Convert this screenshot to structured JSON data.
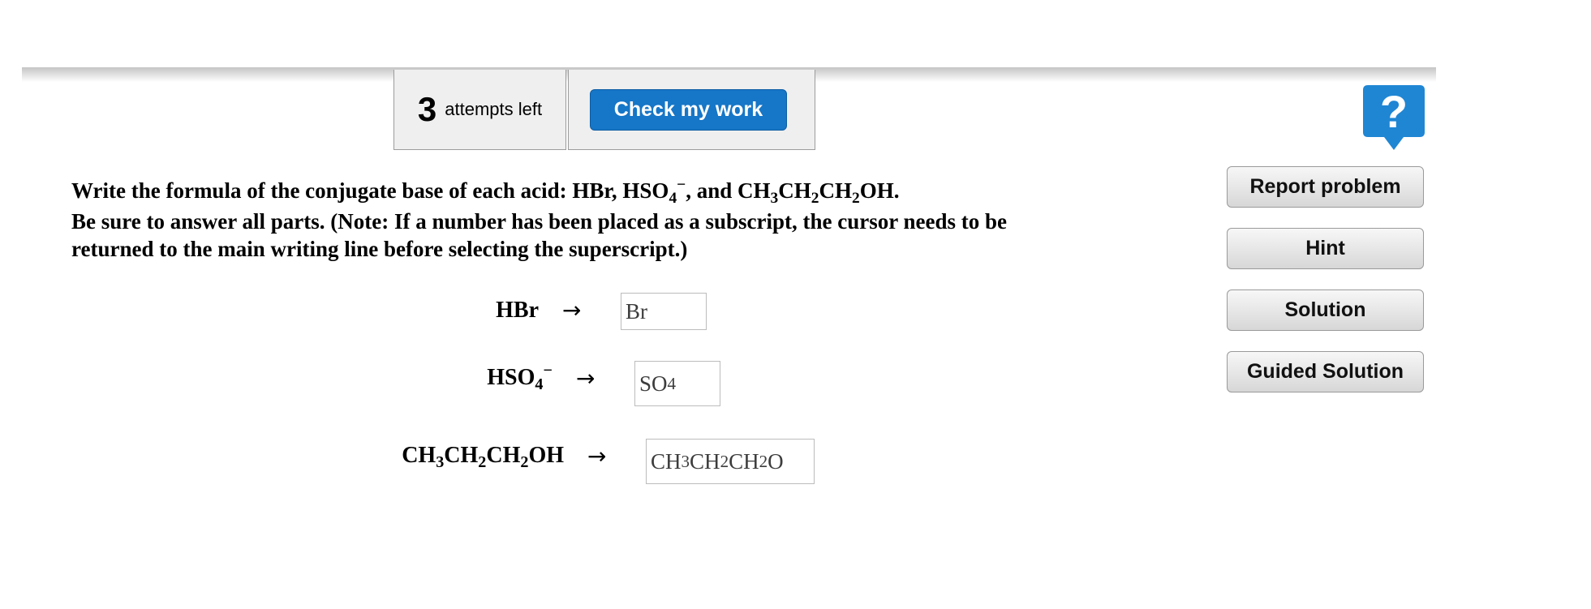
{
  "toolbar": {
    "attempts_count": "3",
    "attempts_text": "attempts left",
    "check_label": "Check my work"
  },
  "help": {
    "icon": "question-icon",
    "glyph": "?"
  },
  "side_buttons": {
    "report": "Report problem",
    "hint": "Hint",
    "solution": "Solution",
    "guided": "Guided Solution"
  },
  "question": {
    "line1": {
      "a": "Write the formula of the conjugate base of each acid: HBr, HSO",
      "sub1": "4",
      "sup1": "−",
      "b": ", and CH",
      "sub2": "3",
      "c": "CH",
      "sub3": "2",
      "d": "CH",
      "sub4": "2",
      "e": "OH."
    },
    "line2": "Be sure to answer all parts. (Note: If a number has been placed as a subscript, the cursor needs to be",
    "line3": "returned to the main writing line before selecting the superscript.)"
  },
  "equations": [
    {
      "label": "HBr",
      "arrow": "→",
      "answer": "Br"
    },
    {
      "label_main": "HSO",
      "label_sub": "4",
      "label_sup": "−",
      "arrow": "→",
      "answer_main": "SO",
      "answer_sub": "4"
    },
    {
      "label_parts": [
        "CH",
        "3",
        "CH",
        "2",
        "CH",
        "2",
        "OH"
      ],
      "arrow": "→",
      "answer_parts": [
        "CH",
        "3",
        "CH",
        "2",
        "CH",
        "2",
        "O"
      ]
    }
  ],
  "colors": {
    "primary_button": "#1676c7",
    "help_icon": "#1f86d4",
    "toolbar_bg": "#efefef"
  }
}
